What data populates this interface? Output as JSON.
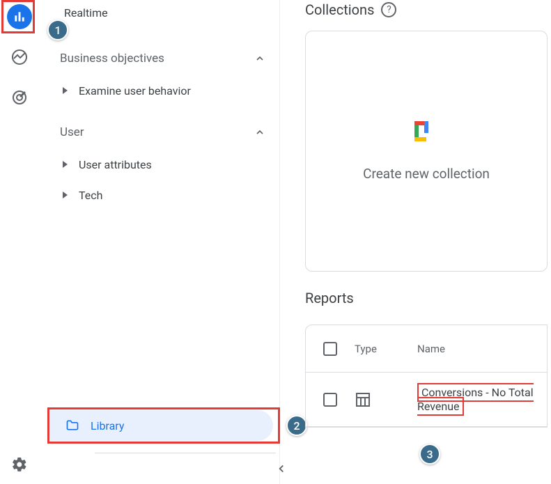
{
  "nav": {
    "realtime": "Realtime",
    "sections": {
      "business": {
        "label": "Business objectives",
        "items": [
          "Examine user behavior"
        ]
      },
      "user": {
        "label": "User",
        "items": [
          "User attributes",
          "Tech"
        ]
      }
    },
    "library": "Library"
  },
  "main": {
    "collections_title": "Collections",
    "create_collection": "Create new collection",
    "reports_title": "Reports",
    "columns": {
      "type": "Type",
      "name": "Name"
    },
    "rows": [
      {
        "name": "Conversions - No Total Revenue"
      }
    ]
  },
  "annotations": {
    "one": "1",
    "two": "2",
    "three": "3"
  }
}
